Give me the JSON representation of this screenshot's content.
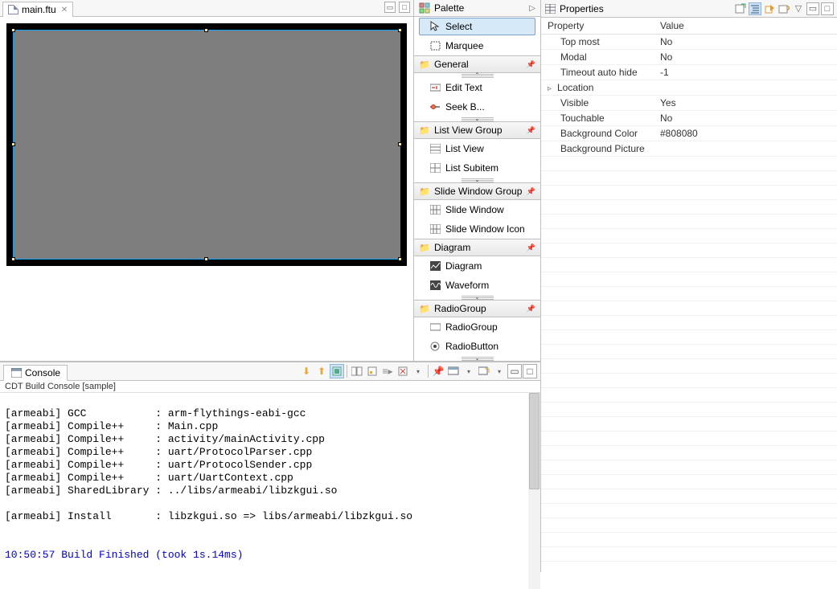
{
  "editor": {
    "tab_filename": "main.ftu"
  },
  "palette": {
    "title": "Palette",
    "items": {
      "select": "Select",
      "marquee": "Marquee"
    },
    "groups": {
      "general": "General",
      "general_items": {
        "edit_text": "Edit Text",
        "seek_bar": "Seek B..."
      },
      "listview": "List View Group",
      "listview_items": {
        "list_view": "List View",
        "list_subitem": "List Subitem"
      },
      "slidewin": "Slide Window Group",
      "slidewin_items": {
        "slide_window": "Slide Window",
        "slide_window_icon": "Slide Window Icon"
      },
      "diagram": "Diagram",
      "diagram_items": {
        "diagram": "Diagram",
        "waveform": "Waveform"
      },
      "radiogroup": "RadioGroup",
      "radiogroup_items": {
        "radiogroup": "RadioGroup",
        "radiobutton": "RadioButton"
      }
    }
  },
  "properties": {
    "title": "Properties",
    "col_property": "Property",
    "col_value": "Value",
    "rows": {
      "top_most": {
        "k": "Top most",
        "v": "No"
      },
      "modal": {
        "k": "Modal",
        "v": "No"
      },
      "timeout": {
        "k": "Timeout auto hide",
        "v": "-1"
      },
      "location": {
        "k": "Location",
        "v": ""
      },
      "visible": {
        "k": "Visible",
        "v": "Yes"
      },
      "touchable": {
        "k": "Touchable",
        "v": "No"
      },
      "bgcolor": {
        "k": "Background Color",
        "v": "#808080"
      },
      "bgpic": {
        "k": "Background Picture",
        "v": ""
      }
    }
  },
  "console": {
    "title": "Console",
    "subtitle": "CDT Build Console [sample]",
    "lines": [
      "[armeabi] GCC           : arm-flythings-eabi-gcc",
      "[armeabi] Compile++     : Main.cpp",
      "[armeabi] Compile++     : activity/mainActivity.cpp",
      "[armeabi] Compile++     : uart/ProtocolParser.cpp",
      "[armeabi] Compile++     : uart/ProtocolSender.cpp",
      "[armeabi] Compile++     : uart/UartContext.cpp",
      "[armeabi] SharedLibrary : ../libs/armeabi/libzkgui.so",
      "",
      "[armeabi] Install       : libzkgui.so => libs/armeabi/libzkgui.so",
      ""
    ],
    "finish_line": "10:50:57 Build Finished (took 1s.14ms)"
  }
}
